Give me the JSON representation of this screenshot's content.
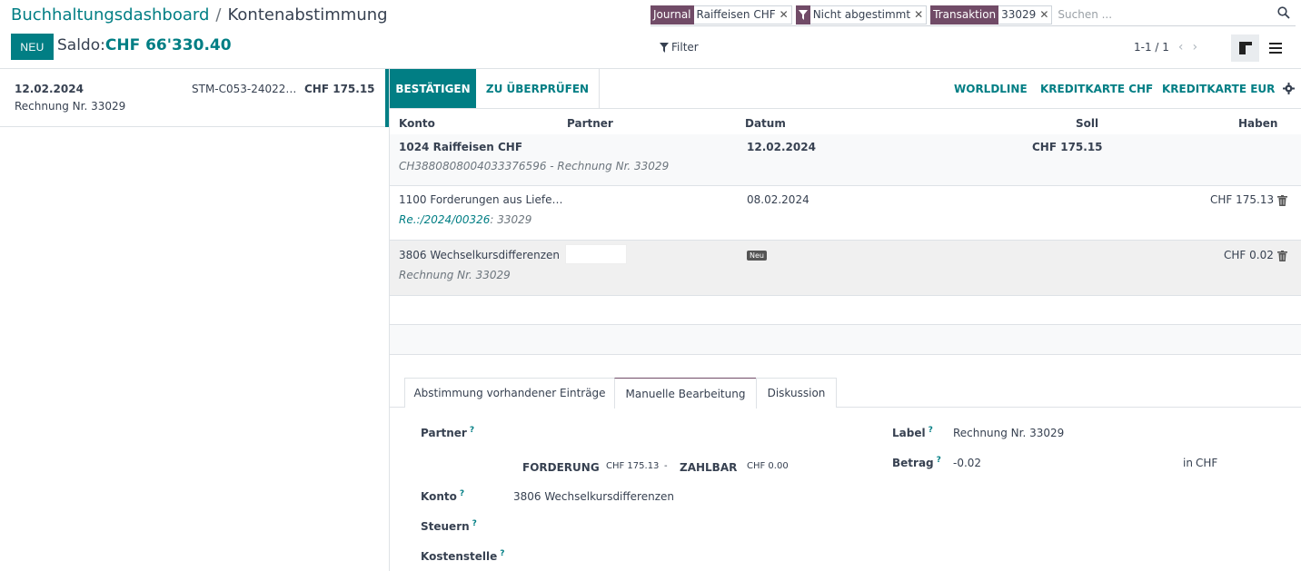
{
  "breadcrumb": {
    "parent": "Buchhaltungsdashboard",
    "separator": "/",
    "current": "Kontenabstimmung"
  },
  "header": {
    "new_label": "NEU",
    "saldo_label": "Saldo:",
    "saldo_value": "CHF 66'330.40"
  },
  "search": {
    "facets": [
      {
        "label": "Journal",
        "value": "Raiffeisen CHF"
      },
      {
        "label": "",
        "value": "Nicht abgestimmt"
      },
      {
        "label": "Transaktion",
        "value": "33029"
      }
    ],
    "placeholder": "Suchen ..."
  },
  "filter_label": "Filter",
  "pager": "1-1 / 1",
  "statement_line": {
    "date": "12.02.2024",
    "ref": "STM-C053-24022…",
    "amount": "CHF 175.15",
    "label": "Rechnung Nr. 33029"
  },
  "actions": {
    "validate": "BESTÄTIGEN",
    "review": "ZU ÜBERPRÜFEN",
    "quick": [
      "WORLDLINE",
      "KREDITKARTE CHF",
      "KREDITKARTE EUR"
    ]
  },
  "columns": {
    "account": "Konto",
    "partner": "Partner",
    "date": "Datum",
    "debit": "Soll",
    "credit": "Haben"
  },
  "lines": [
    {
      "account": "1024 Raiffeisen CHF",
      "sub_link": "",
      "sub": "CH3880808004033376596 - Rechnung Nr. 33029",
      "date": "12.02.2024",
      "debit": "CHF 175.15",
      "credit": ""
    },
    {
      "account": "1100 Forderungen aus Liefe…",
      "sub_link": "Re.:/2024/00326",
      "sub": ": 33029",
      "date": "08.02.2024",
      "debit": "",
      "credit": "CHF 175.13"
    },
    {
      "account": "3806 Wechselkursdifferenzen",
      "sub_link": "",
      "sub": "Rechnung Nr. 33029",
      "badge": "Neu",
      "debit": "",
      "credit": "CHF 0.02"
    }
  ],
  "tabs": [
    "Abstimmung vorhandener Einträge",
    "Manuelle Bearbeitung",
    "Diskussion"
  ],
  "form": {
    "partner_label": "Partner",
    "receivable_label": "FORDERUNG",
    "receivable_value": "CHF 175.13",
    "dash": "-",
    "payable_label": "ZAHLBAR",
    "payable_value": "CHF 0.00",
    "account_label": "Konto",
    "account_value": "3806 Wechselkursdifferenzen",
    "taxes_label": "Steuern",
    "analytic_label": "Kostenstelle",
    "label_label": "Label",
    "label_value": "Rechnung Nr. 33029",
    "amount_label": "Betrag",
    "amount_value": "-0.02",
    "in_label": "in",
    "currency": "CHF",
    "help_mark": "?"
  }
}
